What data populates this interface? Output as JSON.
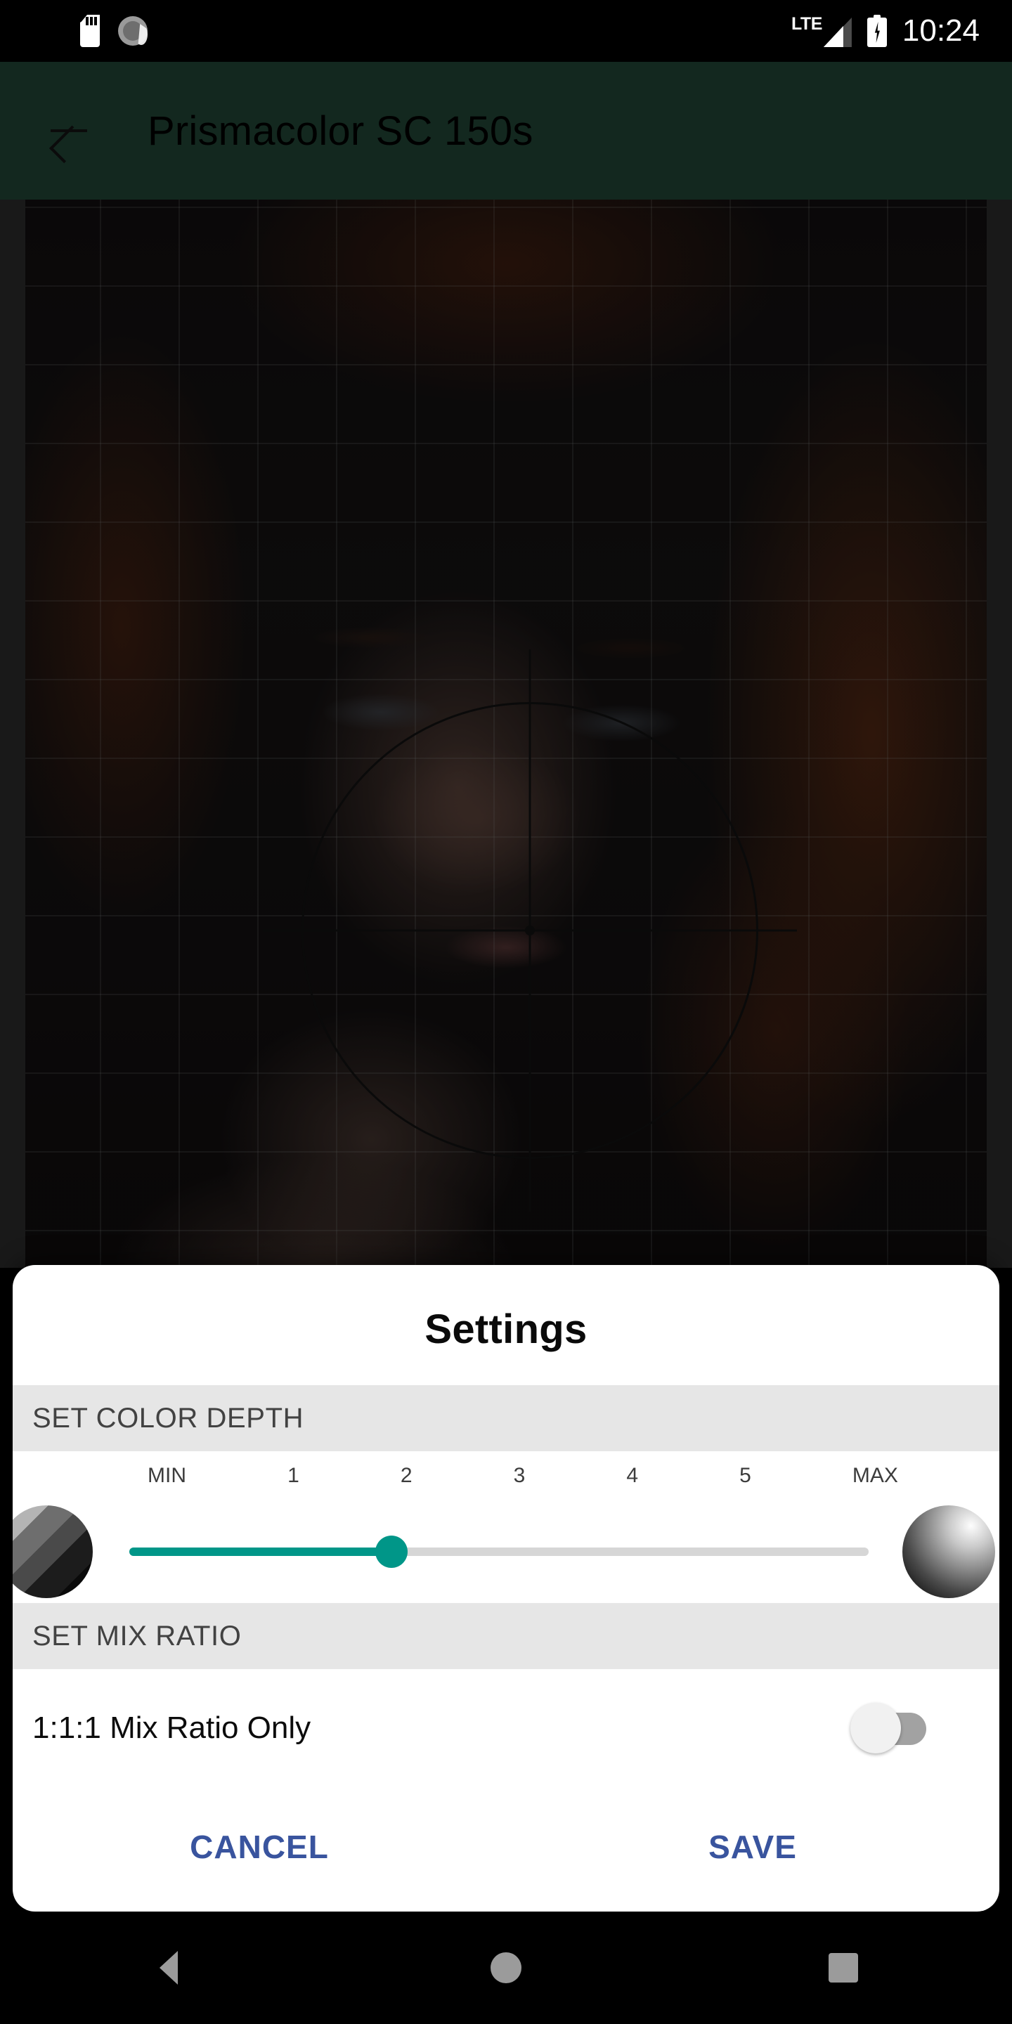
{
  "status_bar": {
    "icons_left": [
      "sdcard-icon",
      "gear-dial-icon"
    ],
    "network_label": "LTE",
    "icons_right": [
      "lte-signal-icon",
      "battery-charging-icon"
    ],
    "time": "10:24"
  },
  "app_bar": {
    "back_icon": "arrow-back-icon",
    "title": "Prismacolor SC 150s",
    "background_color": "#13281F",
    "title_color": "#000000"
  },
  "image_area": {
    "overlay": {
      "grid": "grid-overlay",
      "reticle": "crosshair-target-icon"
    },
    "description": "portrait photo preview with sampling grid and crosshair"
  },
  "dialog": {
    "title": "Settings",
    "sections": [
      {
        "id": "color-depth",
        "header": "SET COLOR DEPTH",
        "slider": {
          "tick_labels": [
            "MIN",
            "1",
            "2",
            "3",
            "4",
            "5",
            "MAX"
          ],
          "value": "2",
          "value_index": 2,
          "min_index": 0,
          "max_index": 6,
          "fill_percent": 33.3,
          "accent_color": "#009688",
          "track_color": "#d6d6d6",
          "left_swatch_icon": "posterized-sphere-icon",
          "right_swatch_icon": "gradient-sphere-icon"
        }
      },
      {
        "id": "mix-ratio",
        "header": "SET MIX RATIO",
        "toggle": {
          "label": "1:1:1 Mix Ratio Only",
          "state": "off",
          "track_color": "#a2a2a2",
          "knob_color": "#f1f1f1"
        }
      }
    ],
    "actions": {
      "cancel_label": "CANCEL",
      "save_label": "SAVE",
      "action_color": "#39549E"
    },
    "section_header_bg": "#E6E6E6",
    "background_color": "#FFFFFF"
  },
  "nav_bar": {
    "back_icon": "nav-back-triangle-icon",
    "home_icon": "nav-home-circle-icon",
    "recents_icon": "nav-recents-square-icon",
    "icon_color": "#9b9b9b"
  }
}
